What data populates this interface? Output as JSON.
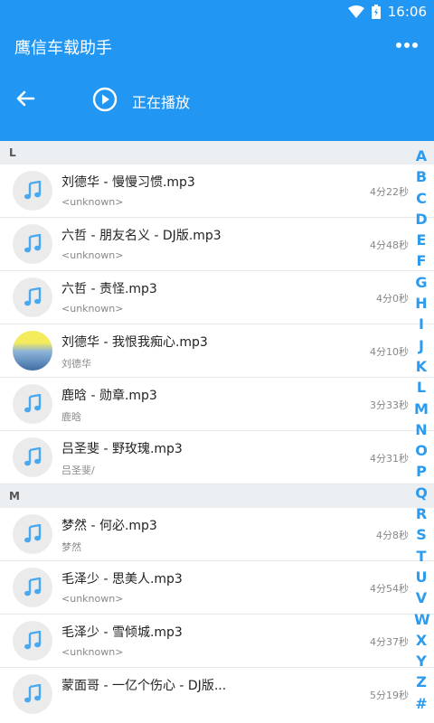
{
  "statusbar": {
    "time": "16:06"
  },
  "app": {
    "title": "鹰信车载助手"
  },
  "player": {
    "label": "正在播放"
  },
  "sections": [
    {
      "letter": "L",
      "songs": [
        {
          "title": "刘德华 - 慢慢习惯.mp3",
          "artist": "<unknown>",
          "duration": "4分22秒",
          "cover": "music-note"
        },
        {
          "title": "六哲 - 朋友名义 - DJ版.mp3",
          "artist": "<unknown>",
          "duration": "4分48秒",
          "cover": "music-note"
        },
        {
          "title": "六哲 - 责怪.mp3",
          "artist": "<unknown>",
          "duration": "4分0秒",
          "cover": "music-note"
        },
        {
          "title": "刘德华 - 我恨我痴心.mp3",
          "artist": "刘德华",
          "duration": "4分10秒",
          "cover": "album-art"
        },
        {
          "title": "鹿晗 - 勋章.mp3",
          "artist": "鹿晗",
          "duration": "3分33秒",
          "cover": "music-note"
        },
        {
          "title": "吕圣斐 - 野玫瑰.mp3",
          "artist": "吕圣斐/",
          "duration": "4分31秒",
          "cover": "music-note"
        }
      ]
    },
    {
      "letter": "M",
      "songs": [
        {
          "title": "梦然 - 何必.mp3",
          "artist": "梦然",
          "duration": "4分8秒",
          "cover": "music-note"
        },
        {
          "title": "毛泽少 - 思美人.mp3",
          "artist": "<unknown>",
          "duration": "4分54秒",
          "cover": "music-note"
        },
        {
          "title": "毛泽少 - 雪倾城.mp3",
          "artist": "<unknown>",
          "duration": "4分37秒",
          "cover": "music-note"
        },
        {
          "title": "蒙面哥 - 一亿个伤心 - DJ版...",
          "artist": "",
          "duration": "5分19秒",
          "cover": "music-note"
        }
      ]
    }
  ],
  "index_letters": [
    "A",
    "B",
    "C",
    "D",
    "E",
    "F",
    "G",
    "H",
    "I",
    "J",
    "K",
    "L",
    "M",
    "N",
    "O",
    "P",
    "Q",
    "R",
    "S",
    "T",
    "U",
    "V",
    "W",
    "X",
    "Y",
    "Z",
    "#"
  ],
  "colors": {
    "primary": "#2196F3",
    "index": "#2b9bf0",
    "note": "#4aa8f0"
  }
}
